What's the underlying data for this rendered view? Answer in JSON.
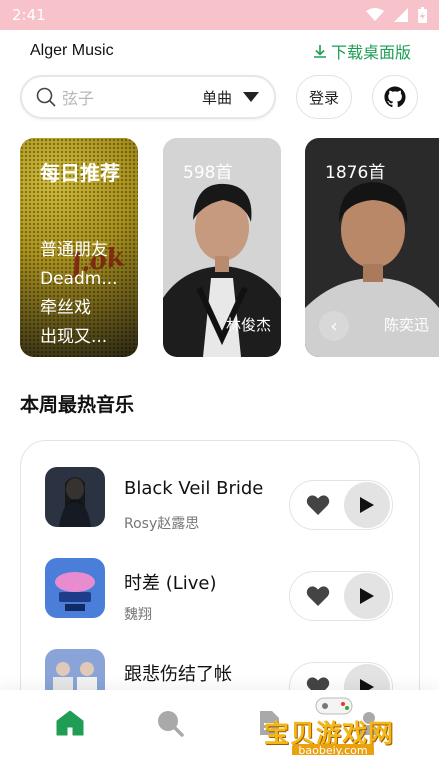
{
  "status_bar": {
    "time": "2:41"
  },
  "header": {
    "title": "Alger Music",
    "download_label": "下载桌面版"
  },
  "search": {
    "placeholder": "弦子",
    "type_selected": "单曲",
    "login_label": "登录"
  },
  "cards": {
    "daily": {
      "title": "每日推荐",
      "songs": [
        "普通朋友",
        "Deadm...",
        "牵丝戏",
        "出现又..."
      ]
    },
    "artists": [
      {
        "count": "598首",
        "name": "林俊杰"
      },
      {
        "count": "1876首",
        "name": "陈奕迅"
      }
    ]
  },
  "section": {
    "title": "本周最热音乐"
  },
  "songs": [
    {
      "name": "Black Veil Bride",
      "artist": "Rosy赵露思"
    },
    {
      "name": "时差 (Live)",
      "artist": "魏翔"
    },
    {
      "name": "跟悲伤结了帐",
      "artist": ""
    }
  ],
  "nav": [
    "home-icon",
    "search-icon",
    "document-icon",
    "user-icon"
  ],
  "watermark": {
    "text": "宝贝游戏网",
    "url": "baobeiy.com"
  },
  "colors": {
    "accent": "#1f9d55",
    "status_bar": "#f8c2cb"
  }
}
